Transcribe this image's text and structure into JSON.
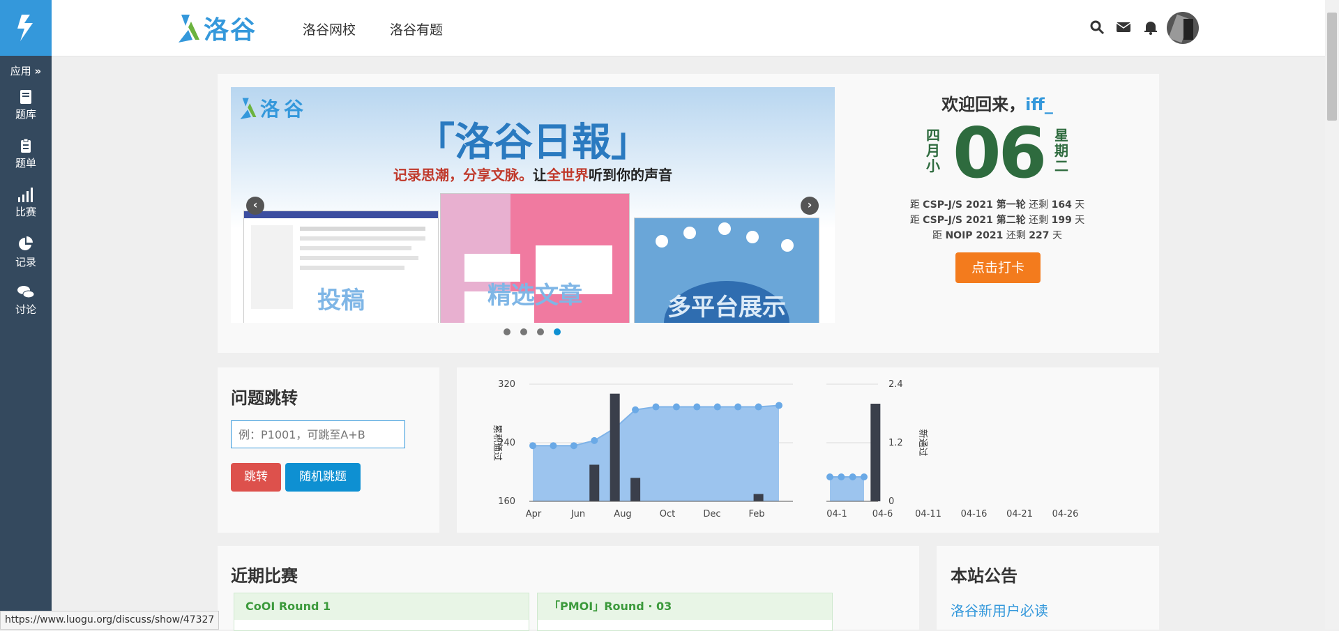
{
  "sidebar": {
    "apps_label": "应用",
    "items": [
      {
        "label": "题库",
        "icon": "book-icon"
      },
      {
        "label": "题单",
        "icon": "clipboard-icon"
      },
      {
        "label": "比赛",
        "icon": "bar-chart-icon"
      },
      {
        "label": "记录",
        "icon": "pie-chart-icon"
      },
      {
        "label": "讨论",
        "icon": "chat-icon"
      }
    ]
  },
  "header": {
    "logo_text": "洛谷",
    "nav": [
      "洛谷网校",
      "洛谷有题"
    ]
  },
  "banner": {
    "logo_text": "洛谷",
    "title": "「洛谷日報」",
    "tagline_red1": "记录思潮，分享文脉。",
    "tagline_black1": "让",
    "tagline_red2": "全世界",
    "tagline_black2": "听到你的声音",
    "panel_labels": [
      "投稿",
      "精选文章",
      "多平台展示"
    ],
    "dots": 4,
    "active_dot": 3
  },
  "welcome": {
    "greeting": "欢迎回来，",
    "username": "iff_",
    "lunar": "四月小",
    "day": "06",
    "weekday": "星期二",
    "countdowns": [
      {
        "pre": "距",
        "event": "CSP-J/S 2021 第一轮",
        "mid": "还剩",
        "days": "164",
        "unit": "天"
      },
      {
        "pre": "距",
        "event": "CSP-J/S 2021 第二轮",
        "mid": "还剩",
        "days": "199",
        "unit": "天"
      },
      {
        "pre": "距",
        "event": "NOIP 2021",
        "mid": "还剩",
        "days": "227",
        "unit": "天"
      }
    ],
    "checkin_button": "点击打卡"
  },
  "jump": {
    "title": "问题跳转",
    "placeholder": "例：P1001，可跳至A+B",
    "jump_button": "跳转",
    "random_button": "随机跳题"
  },
  "chart_data": [
    {
      "type": "area",
      "ylabel": "累积通过",
      "yticks": [
        160,
        240,
        320
      ],
      "ylim": [
        160,
        320
      ],
      "xticks": [
        "Apr",
        "Jun",
        "Aug",
        "Oct",
        "Dec",
        "Feb"
      ],
      "line_values": [
        236,
        236,
        236,
        243,
        260,
        285,
        289,
        289,
        289,
        289,
        289,
        289,
        291
      ],
      "bar_values": [
        0,
        0,
        0,
        210,
        307,
        192,
        0,
        0,
        0,
        0,
        0,
        170,
        0
      ]
    },
    {
      "type": "area",
      "ylabel": "新通过",
      "yticks": [
        0,
        1.2,
        2.4
      ],
      "ylim": [
        0,
        2.4
      ],
      "xticks": [
        "04-1",
        "04-6",
        "04-11",
        "04-16",
        "04-21",
        "04-26"
      ],
      "line_values": [
        0.5,
        0.5,
        0.5,
        0.5
      ],
      "bar_values": [
        0,
        0,
        0,
        0,
        2.0
      ]
    }
  ],
  "contests": {
    "title": "近期比赛",
    "items": [
      "CoOI Round 1",
      "「PMOI」Round · 03"
    ]
  },
  "announcements": {
    "title": "本站公告",
    "items": [
      "洛谷新用户必读"
    ]
  },
  "status_url": "https://www.luogu.org/discuss/show/47327",
  "colors": {
    "sidebar": "#34495e",
    "accent": "#3498db",
    "orange": "#f37b1d",
    "red": "#dd514c",
    "green": "#2e6b3e"
  }
}
